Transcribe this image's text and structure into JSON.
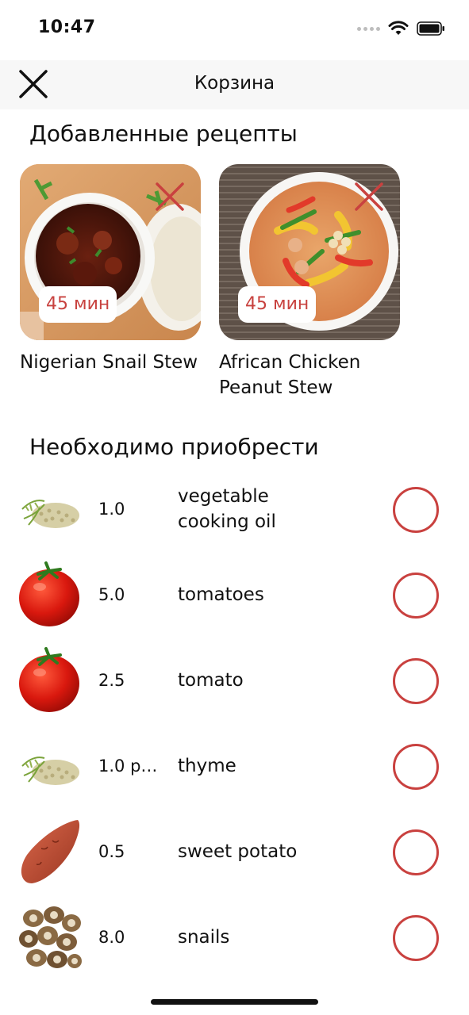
{
  "status_bar": {
    "time": "10:47"
  },
  "nav": {
    "title": "Корзина",
    "close_icon": "close-x-icon"
  },
  "recipes_section": {
    "title": "Добавленные рецепты",
    "items": [
      {
        "name": "Nigerian Snail Stew",
        "time": "45 мин"
      },
      {
        "name": "African Chicken Peanut Stew",
        "time": "45 мин"
      }
    ]
  },
  "shopping_section": {
    "title": "Необходимо приобрести",
    "items": [
      {
        "qty": "1.0",
        "name": "vegetable cooking oil",
        "icon": "herbs-image"
      },
      {
        "qty": "5.0",
        "name": "tomatoes",
        "icon": "tomato-image"
      },
      {
        "qty": "2.5",
        "name": "tomato",
        "icon": "tomato-image"
      },
      {
        "qty": "1.0 p…",
        "name": "thyme",
        "icon": "herbs-image"
      },
      {
        "qty": "0.5",
        "name": "sweet potato",
        "icon": "sweet-potato-image"
      },
      {
        "qty": "8.0",
        "name": "snails",
        "icon": "snails-image"
      }
    ]
  },
  "colors": {
    "accent": "#c9413f",
    "badge_text": "#c8423f"
  }
}
